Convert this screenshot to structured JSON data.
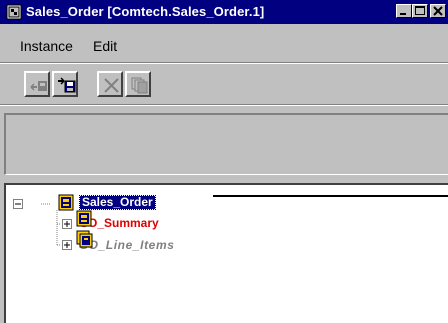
{
  "window": {
    "title": "Sales_Order [Comtech.Sales_Order.1]",
    "title_icon": "object-icon",
    "controls": [
      "minimize-icon",
      "maximize-icon",
      "close-icon"
    ]
  },
  "menu": {
    "items": [
      {
        "label": "Instance"
      },
      {
        "label": "Edit"
      }
    ]
  },
  "toolbar": {
    "buttons": [
      {
        "icon": "move-left-icon",
        "enabled": false
      },
      {
        "icon": "insert-icon",
        "enabled": true
      },
      {
        "icon": "delete-icon",
        "enabled": false
      },
      {
        "icon": "copy-icon",
        "enabled": false
      }
    ]
  },
  "tree": {
    "nodes": [
      {
        "label": "Sales_Order",
        "level": 0,
        "expanded": true,
        "selected": true,
        "icon": "object-icon"
      },
      {
        "label": "SO_Summary",
        "level": 1,
        "expanded": false,
        "color": "#e00000",
        "icon": "object-icon"
      },
      {
        "label": "SO_Line_Items",
        "level": 1,
        "expanded": false,
        "color": "#808080",
        "icon": "collection-icon"
      }
    ]
  },
  "colors": {
    "titlebar": "#000080",
    "face": "#c0c0c0",
    "highlight_red": "#e00000",
    "disabled_gray": "#808080"
  }
}
